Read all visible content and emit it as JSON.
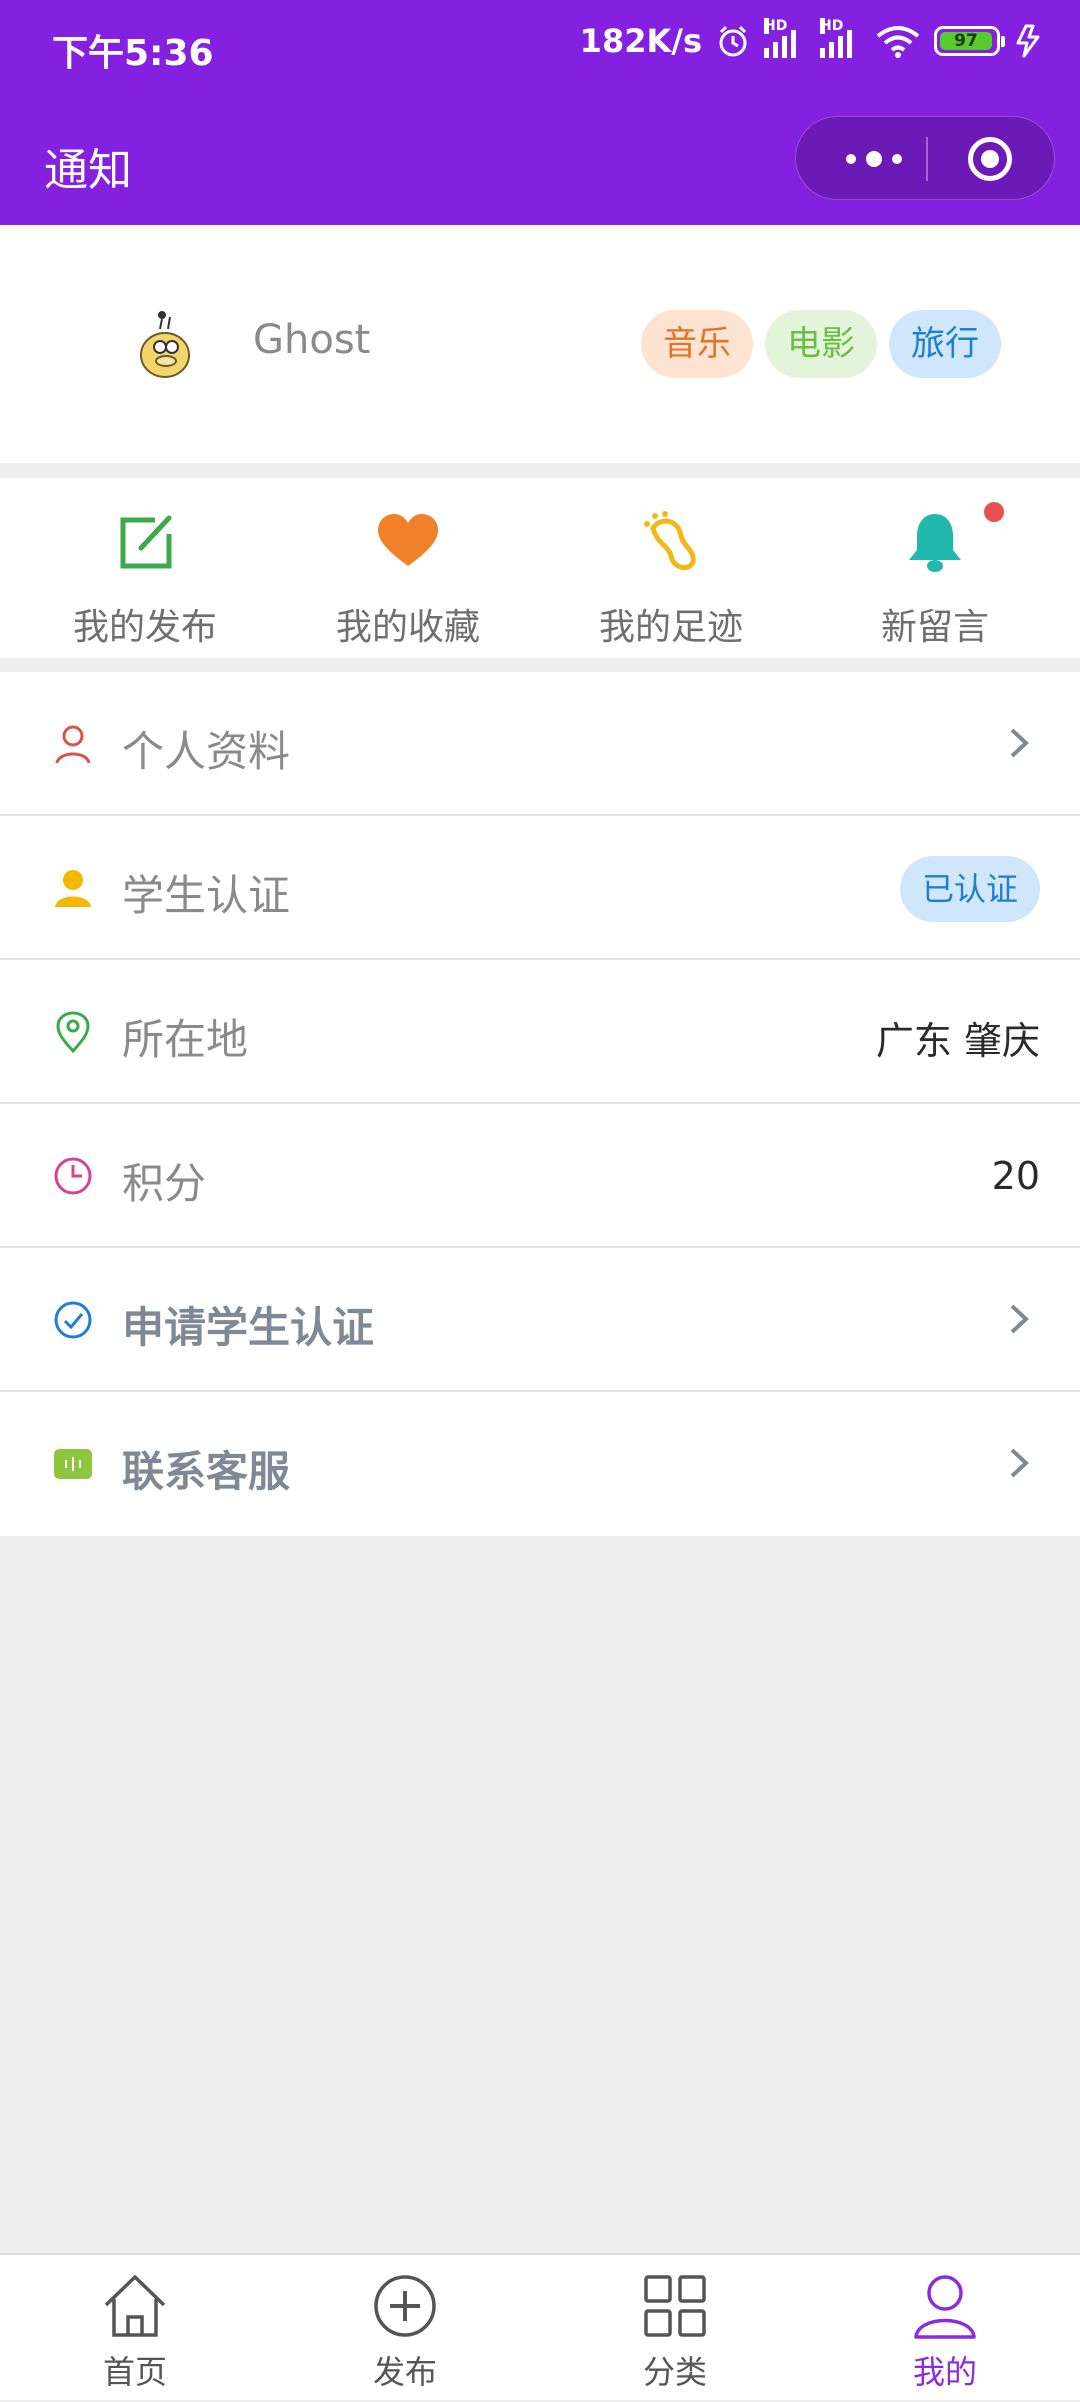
{
  "status_bar": {
    "time": "下午5:36",
    "speed": "182K/s",
    "battery": "97",
    "hd1": "HD",
    "hd2": "HD"
  },
  "nav": {
    "title": "通知"
  },
  "profile": {
    "username": "Ghost",
    "tags": [
      "音乐",
      "电影",
      "旅行"
    ]
  },
  "quick_actions": [
    {
      "label": "我的发布",
      "icon": "edit-icon"
    },
    {
      "label": "我的收藏",
      "icon": "heart-icon"
    },
    {
      "label": "我的足迹",
      "icon": "footprint-icon"
    },
    {
      "label": "新留言",
      "icon": "bell-icon"
    }
  ],
  "menu": {
    "profile_label": "个人资料",
    "student_auth_label": "学生认证",
    "student_auth_status": "已认证",
    "location_label": "所在地",
    "location_value": "广东 肇庆",
    "points_label": "积分",
    "points_value": "20",
    "apply_auth_label": "申请学生认证",
    "contact_label": "联系客服"
  },
  "tabbar": [
    {
      "label": "首页",
      "icon": "home-icon"
    },
    {
      "label": "发布",
      "icon": "plus-circle-icon"
    },
    {
      "label": "分类",
      "icon": "grid-icon"
    },
    {
      "label": "我的",
      "icon": "user-icon"
    }
  ],
  "colors": {
    "header": "#8420e0",
    "active_tab": "#8a2be2"
  }
}
